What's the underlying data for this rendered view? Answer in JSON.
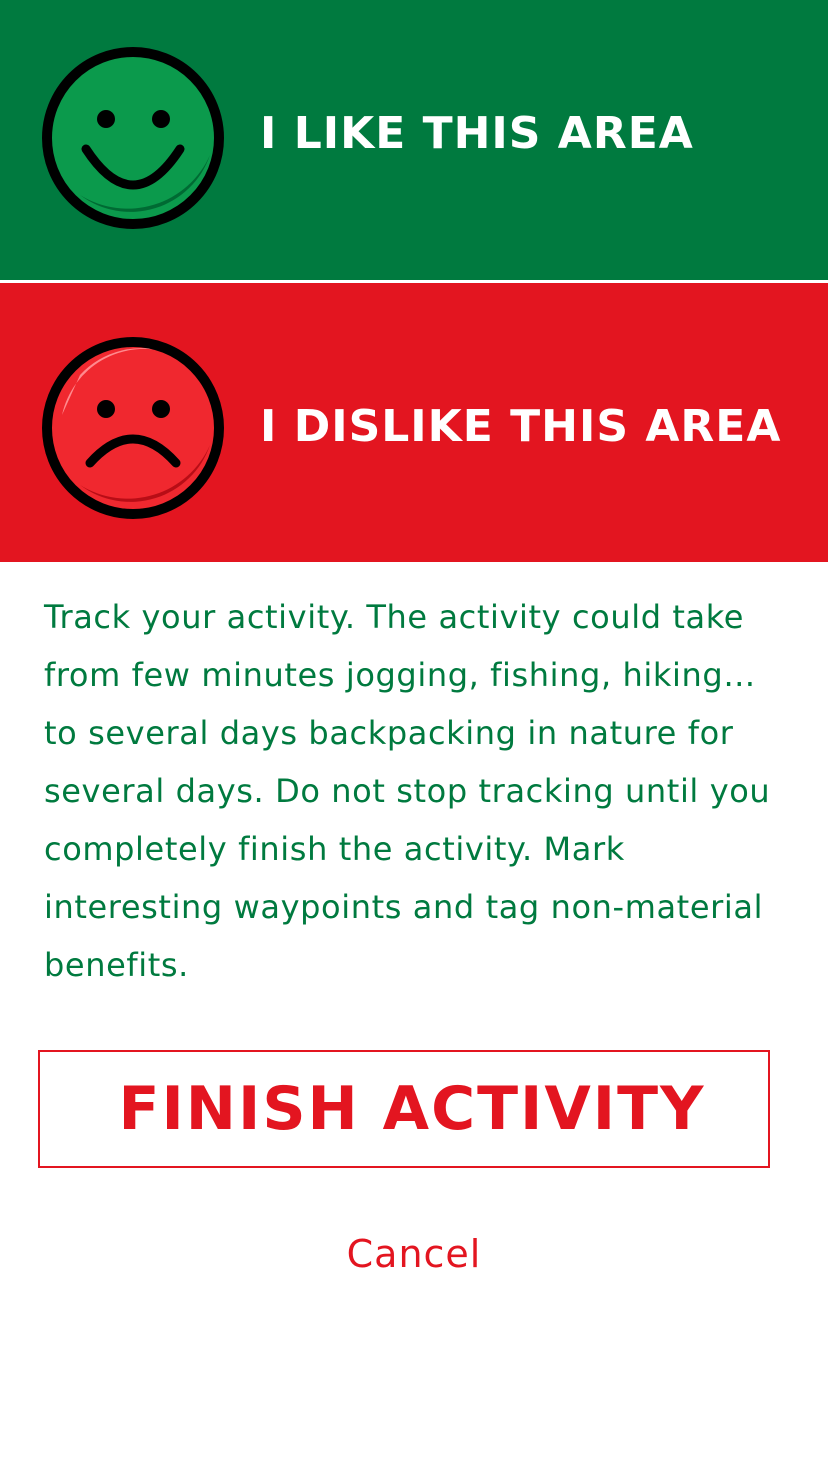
{
  "like_button": {
    "label": "I LIKE THIS AREA",
    "icon": "smiley-face-icon",
    "color": "#007a3f"
  },
  "dislike_button": {
    "label": "I DISLIKE THIS AREA",
    "icon": "sad-face-icon",
    "color": "#e31520"
  },
  "description": "Track your activity. The activity could take from few minutes jogging, fishing, hiking… to several days backpacking in nature for several days. Do not stop tracking until you completely finish the activity. Mark interesting waypoints and tag non-material benefits.",
  "finish_button": {
    "label": "FINISH ACTIVITY"
  },
  "cancel_button": {
    "label": "Cancel"
  }
}
